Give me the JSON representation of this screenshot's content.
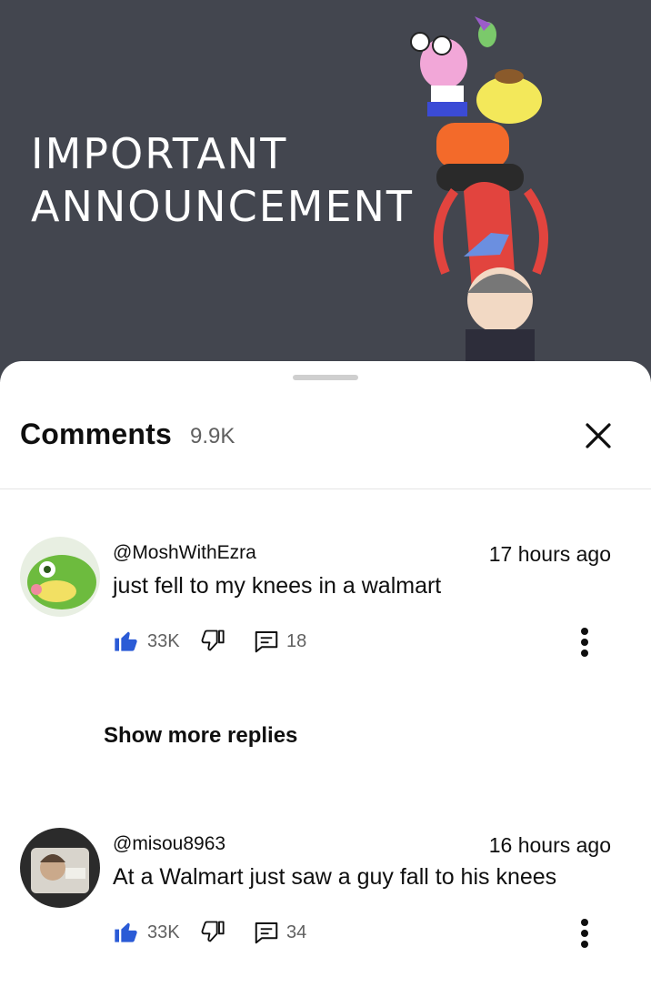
{
  "video": {
    "title_line1": "IMPORTANT",
    "title_line2": "ANNOUNCEMENT"
  },
  "comments_panel": {
    "title": "Comments",
    "count": "9.9K",
    "close_icon": "close-icon"
  },
  "comments": [
    {
      "author": "@MoshWithEzra",
      "time": "17 hours ago",
      "text": "just fell to my knees in a walmart",
      "likes": "33K",
      "replies": "18"
    },
    {
      "author": "@misou8963",
      "time": "16 hours ago",
      "text": "At a Walmart just saw a guy fall to his knees",
      "likes": "33K",
      "replies": "34"
    }
  ],
  "show_more_replies": "Show more replies",
  "colors": {
    "video_bg": "#43464f",
    "like_active": "#2b5bd6",
    "secondary_text": "#606060"
  }
}
